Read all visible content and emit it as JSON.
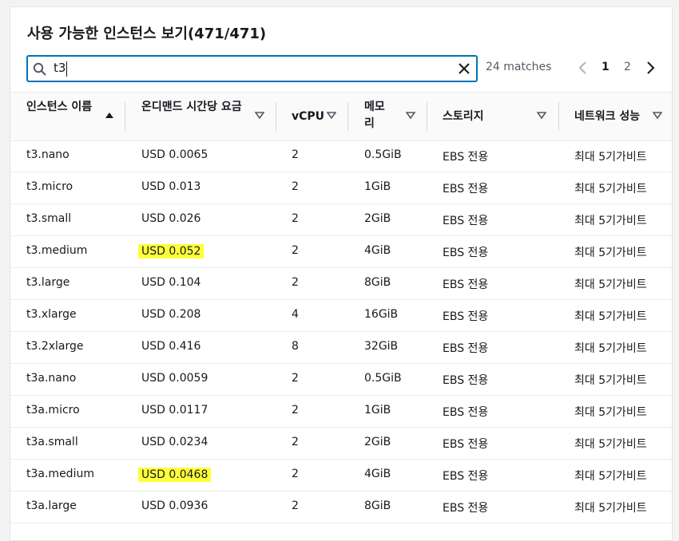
{
  "title": "사용 가능한 인스턴스 보기(471/471)",
  "search": {
    "value": "t3",
    "placeholder": ""
  },
  "matches_text": "24 matches",
  "pagination": {
    "pages": [
      "1",
      "2"
    ],
    "current": "1"
  },
  "columns": [
    "인스턴스 이름",
    "온디맨드 시간당 요금",
    "vCPU",
    "메모리",
    "스토리지",
    "네트워크 성능"
  ],
  "rows": [
    {
      "name": "t3.nano",
      "price": "USD 0.0065",
      "vcpu": "2",
      "memory": "0.5GiB",
      "storage": "EBS 전용",
      "network": "최대 5기가비트",
      "highlight": false
    },
    {
      "name": "t3.micro",
      "price": "USD 0.013",
      "vcpu": "2",
      "memory": "1GiB",
      "storage": "EBS 전용",
      "network": "최대 5기가비트",
      "highlight": false
    },
    {
      "name": "t3.small",
      "price": "USD 0.026",
      "vcpu": "2",
      "memory": "2GiB",
      "storage": "EBS 전용",
      "network": "최대 5기가비트",
      "highlight": false
    },
    {
      "name": "t3.medium",
      "price": "USD 0.052",
      "vcpu": "2",
      "memory": "4GiB",
      "storage": "EBS 전용",
      "network": "최대 5기가비트",
      "highlight": true
    },
    {
      "name": "t3.large",
      "price": "USD 0.104",
      "vcpu": "2",
      "memory": "8GiB",
      "storage": "EBS 전용",
      "network": "최대 5기가비트",
      "highlight": false
    },
    {
      "name": "t3.xlarge",
      "price": "USD 0.208",
      "vcpu": "4",
      "memory": "16GiB",
      "storage": "EBS 전용",
      "network": "최대 5기가비트",
      "highlight": false
    },
    {
      "name": "t3.2xlarge",
      "price": "USD 0.416",
      "vcpu": "8",
      "memory": "32GiB",
      "storage": "EBS 전용",
      "network": "최대 5기가비트",
      "highlight": false
    },
    {
      "name": "t3a.nano",
      "price": "USD 0.0059",
      "vcpu": "2",
      "memory": "0.5GiB",
      "storage": "EBS 전용",
      "network": "최대 5기가비트",
      "highlight": false
    },
    {
      "name": "t3a.micro",
      "price": "USD 0.0117",
      "vcpu": "2",
      "memory": "1GiB",
      "storage": "EBS 전용",
      "network": "최대 5기가비트",
      "highlight": false
    },
    {
      "name": "t3a.small",
      "price": "USD 0.0234",
      "vcpu": "2",
      "memory": "2GiB",
      "storage": "EBS 전용",
      "network": "최대 5기가비트",
      "highlight": false
    },
    {
      "name": "t3a.medium",
      "price": "USD 0.0468",
      "vcpu": "2",
      "memory": "4GiB",
      "storage": "EBS 전용",
      "network": "최대 5기가비트",
      "highlight": true
    },
    {
      "name": "t3a.large",
      "price": "USD 0.0936",
      "vcpu": "2",
      "memory": "8GiB",
      "storage": "EBS 전용",
      "network": "최대 5기가비트",
      "highlight": false
    }
  ],
  "colors": {
    "accent": "#0073bb",
    "highlight": "#ffff3a",
    "text": "#16191f"
  }
}
